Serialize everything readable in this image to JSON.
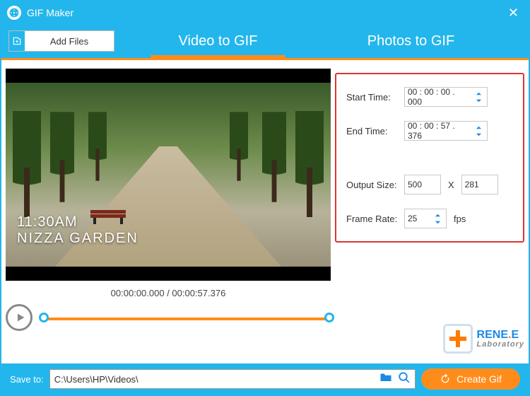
{
  "titlebar": {
    "title": "GIF Maker"
  },
  "tabs": {
    "add_files": "Add Files",
    "video_to_gif": "Video to GIF",
    "photos_to_gif": "Photos to GIF"
  },
  "preview": {
    "overlay_time": "11:30AM",
    "overlay_place": "NIZZA GARDEN",
    "time_display": "00:00:00.000 / 00:00:57.376"
  },
  "settings": {
    "start_time_label": "Start Time:",
    "start_time_value": "00 : 00 : 00 . 000",
    "end_time_label": "End Time:",
    "end_time_value": "00 : 00 : 57 . 376",
    "output_size_label": "Output Size:",
    "output_w": "500",
    "x_label": "X",
    "output_h": "281",
    "frame_rate_label": "Frame Rate:",
    "frame_rate_value": "25",
    "fps_label": "fps"
  },
  "brand": {
    "name_a": "RENE",
    "name_b": "E",
    "sub": "Laboratory"
  },
  "bottom": {
    "saveto_label": "Save to:",
    "path_value": "C:\\Users\\HP\\Videos\\",
    "create_label": "Create Gif"
  }
}
